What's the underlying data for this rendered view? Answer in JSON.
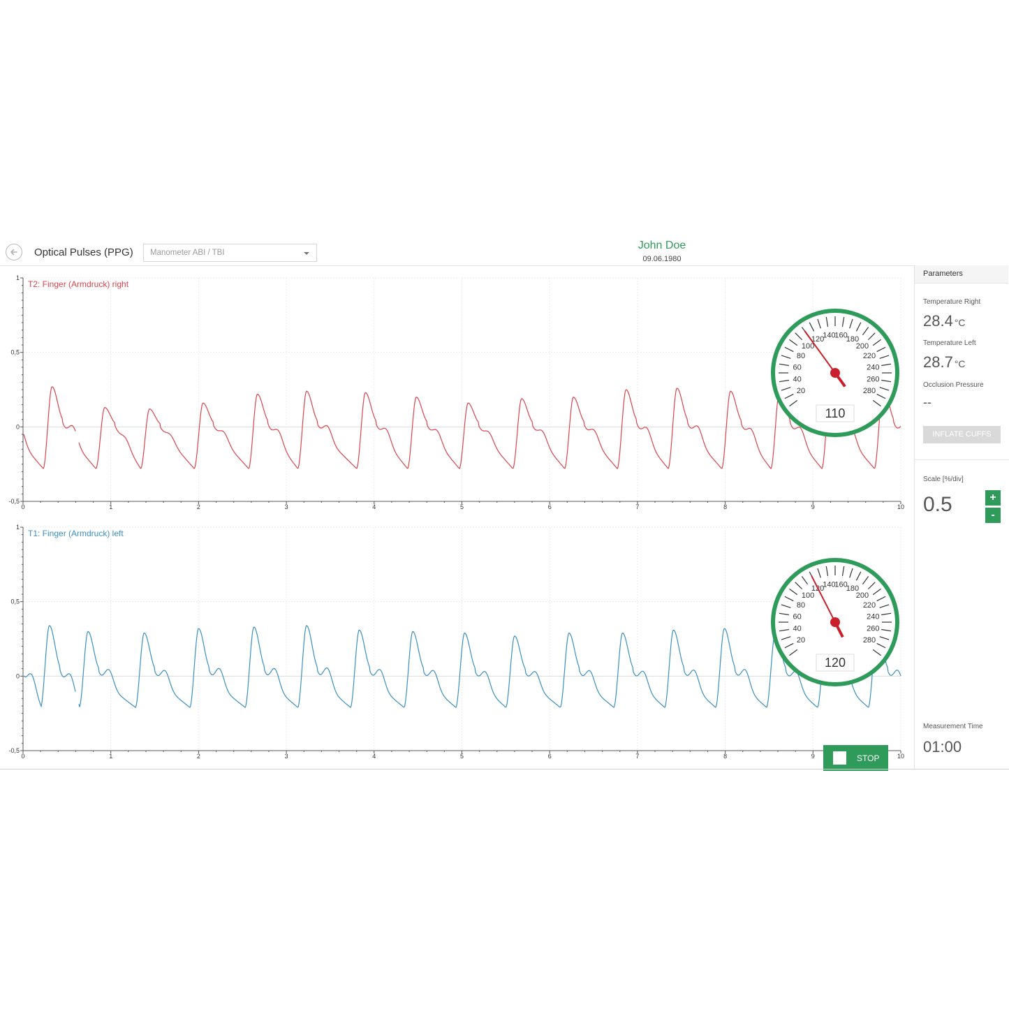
{
  "header": {
    "title": "Optical Pulses (PPG)",
    "mode_select": "Manometer ABI / TBI",
    "patient_name": "John Doe",
    "patient_dob": "09.06.1980"
  },
  "sidebar": {
    "heading": "Parameters",
    "temp_right_label": "Temperature Right",
    "temp_right_value": "28.4",
    "temp_right_unit": "°C",
    "temp_left_label": "Temperature Left",
    "temp_left_value": "28.7",
    "temp_left_unit": "°C",
    "occlusion_label": "Occlusion Pressure",
    "occlusion_value": "--",
    "inflate_label": "INFLATE CUFFS",
    "scale_label": "Scale [%/div]",
    "scale_value": "0.5",
    "plus_label": "+",
    "minus_label": "-",
    "measure_time_label": "Measurement Time",
    "measure_time_value": "01:00"
  },
  "stop_label": "STOP",
  "colors": {
    "accent": "#2e9b5b",
    "right": "#d9444c",
    "left": "#3b8fbf"
  },
  "chart_data": [
    {
      "type": "line",
      "title": "T2: Finger (Armdruck) right",
      "xlim": [
        0,
        10
      ],
      "ylim": [
        -0.5,
        1
      ],
      "x_ticks": [
        0,
        1,
        2,
        3,
        4,
        5,
        6,
        7,
        8,
        9,
        10
      ],
      "y_ticks": [
        "1",
        "0,5",
        "0",
        "-0,5"
      ],
      "grid": true,
      "series": [
        {
          "beats_t": [
            0.33,
            0.93,
            1.44,
            2.05,
            2.67,
            3.23,
            3.9,
            4.48,
            5.07,
            5.68,
            6.27,
            6.87,
            7.45,
            8.06,
            8.62,
            9.2,
            9.8
          ],
          "beats_amp": [
            0.27,
            0.13,
            0.12,
            0.16,
            0.22,
            0.24,
            0.23,
            0.2,
            0.16,
            0.19,
            0.2,
            0.25,
            0.26,
            0.24,
            0.25,
            0.25,
            0.27
          ],
          "trough": -0.28,
          "gap_x": [
            0.62,
            0.62
          ]
        }
      ],
      "gauge": {
        "value": 110,
        "min": 0,
        "max": 300,
        "scale_labels": [
          20,
          40,
          60,
          80,
          100,
          120,
          140,
          160,
          180,
          200,
          220,
          240,
          260,
          280
        ]
      }
    },
    {
      "type": "line",
      "title": "T1: Finger (Armdruck) left",
      "xlim": [
        0,
        10
      ],
      "ylim": [
        -0.5,
        1
      ],
      "x_ticks": [
        0,
        1,
        2,
        3,
        4,
        5,
        6,
        7,
        8,
        9,
        10
      ],
      "y_ticks": [
        "1",
        "0,5",
        "0",
        "-0,5"
      ],
      "grid": true,
      "series": [
        {
          "beats_t": [
            0.3,
            0.74,
            1.38,
            2.0,
            2.63,
            3.23,
            3.83,
            4.44,
            5.03,
            5.6,
            6.22,
            6.83,
            7.41,
            7.99,
            8.57,
            9.15,
            9.73
          ],
          "beats_amp": [
            0.34,
            0.3,
            0.29,
            0.32,
            0.33,
            0.34,
            0.31,
            0.3,
            0.29,
            0.27,
            0.29,
            0.29,
            0.31,
            0.32,
            0.29,
            0.27,
            0.31
          ],
          "trough": -0.21,
          "gap_x": [
            0.62,
            0.62
          ]
        }
      ],
      "gauge": {
        "value": 120,
        "min": 0,
        "max": 300,
        "scale_labels": [
          20,
          40,
          60,
          80,
          100,
          120,
          140,
          160,
          180,
          200,
          220,
          240,
          260,
          280
        ]
      }
    }
  ]
}
